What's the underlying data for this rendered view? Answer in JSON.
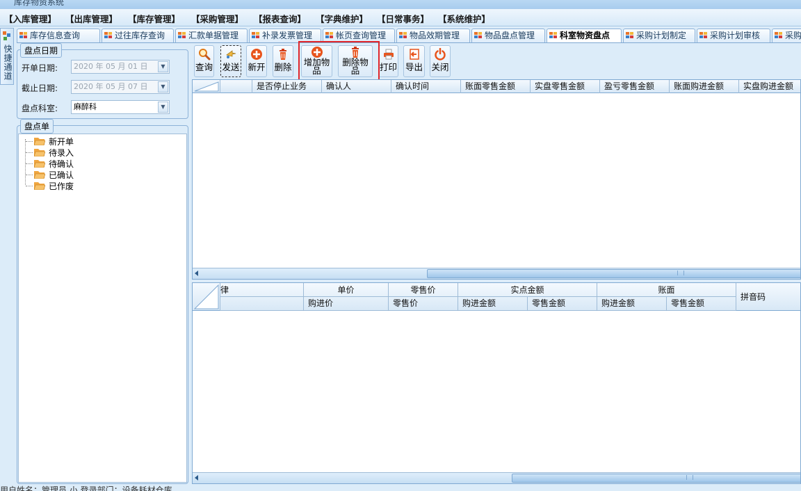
{
  "window": {
    "title": "库存物资系统"
  },
  "menu": [
    "【入库管理】",
    "【出库管理】",
    "【库存管理】",
    "【采购管理】",
    "【报表查询】",
    "【字典维护】",
    "【日常事务】",
    "【系统维护】"
  ],
  "tabs": [
    {
      "label": "库存信息查询",
      "active": false
    },
    {
      "label": "过往库存查询",
      "active": false
    },
    {
      "label": "汇款单据管理",
      "active": false
    },
    {
      "label": "补录发票管理",
      "active": false
    },
    {
      "label": "帐页查询管理",
      "active": false
    },
    {
      "label": "物品效期管理",
      "active": false
    },
    {
      "label": "物品盘点管理",
      "active": false
    },
    {
      "label": "科室物资盘点",
      "active": true
    },
    {
      "label": "采购计划制定",
      "active": false
    },
    {
      "label": "采购计划审核",
      "active": false
    },
    {
      "label": "采购",
      "active": false
    }
  ],
  "quickbar": {
    "label": "快捷通道"
  },
  "filter": {
    "title": "盘点日期",
    "start_label": "开单日期:",
    "start_value": "2020 年 05 月 01 日",
    "end_label": "截止日期:",
    "end_value": "2020 年 05 月 07 日",
    "dept_label": "盘点科室:",
    "dept_value": "麻醉科"
  },
  "tree": {
    "title": "盘点单",
    "items": [
      "新开单",
      "待录入",
      "待确认",
      "已确认",
      "已作废"
    ]
  },
  "toolbar": {
    "query": "查询",
    "send": "发送",
    "new": "新开",
    "delete": "删除",
    "add_item_line1": "增加物",
    "add_item_line2": "品",
    "del_item_line1": "删除物",
    "del_item_line2": "品",
    "print": "打印",
    "export": "导出",
    "close": "关闭"
  },
  "top_grid": {
    "columns": [
      "是否停止业务",
      "确认人",
      "确认时间",
      "账面零售金额",
      "实盘零售金额",
      "盈亏零售金额",
      "账面购进金额",
      "实盘购进金额"
    ]
  },
  "bottom_grid": {
    "cut_label": "律",
    "unit_price": "单价",
    "purchase_price": "购进价",
    "retail_price_group": "零售价",
    "retail_price": "零售价",
    "actual_group": "实点金额",
    "actual_purchase": "购进金额",
    "actual_retail": "零售金额",
    "book_group": "账面",
    "book_purchase": "购进金额",
    "book_retail": "零售金额",
    "pinyin": "拼音码"
  },
  "status": {
    "text": "用户姓名：管理员  小  登录部门：设备耗材仓库"
  },
  "colors": {
    "accent": "#dcecf9",
    "highlight": "#e0262b",
    "border": "#7fa9d2"
  }
}
